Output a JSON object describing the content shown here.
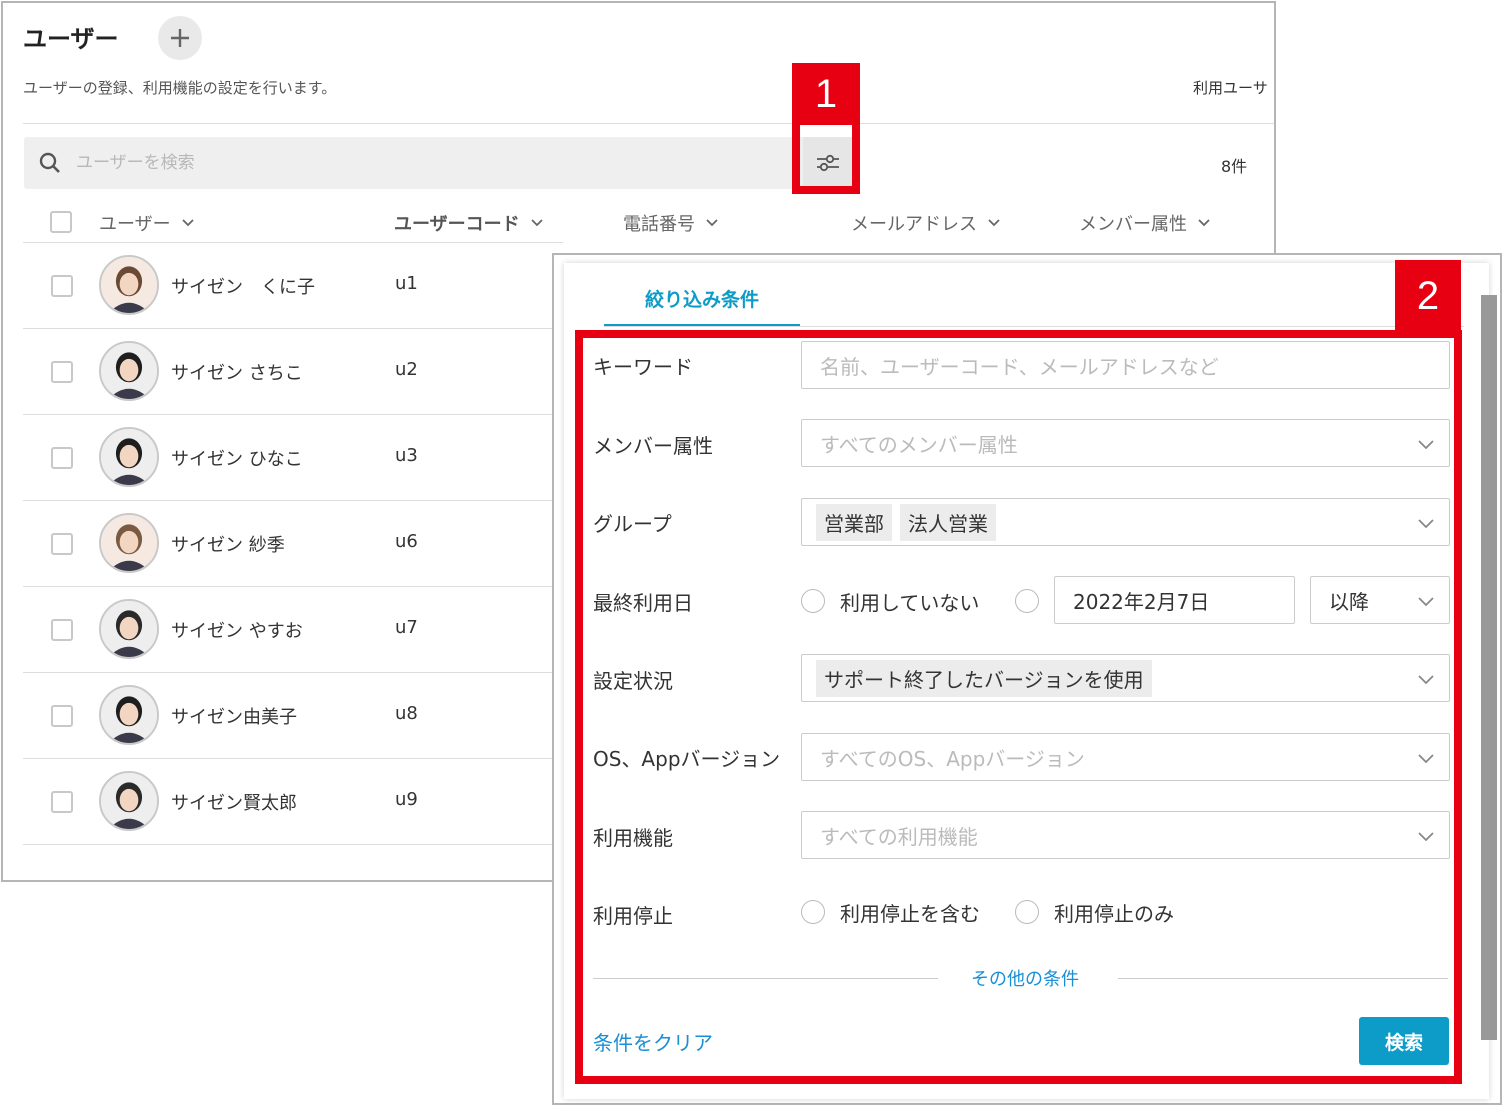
{
  "header": {
    "title": "ユーザー",
    "description": "ユーザーの登録、利用機能の設定を行います。",
    "usage_label": "利用ユーサ"
  },
  "search": {
    "placeholder": "ユーザーを検索",
    "count": "8件"
  },
  "columns": [
    "ユーザー",
    "ユーザーコード",
    "電話番号",
    "メールアドレス",
    "メンバー属性"
  ],
  "rows": [
    {
      "name": "サイゼン　くに子",
      "code": "u1"
    },
    {
      "name": "サイゼン さちこ",
      "code": "u2"
    },
    {
      "name": "サイゼン ひなこ",
      "code": "u3"
    },
    {
      "name": "サイゼン 紗季",
      "code": "u6"
    },
    {
      "name": "サイゼン やすお",
      "code": "u7"
    },
    {
      "name": "サイゼン由美子",
      "code": "u8"
    },
    {
      "name": "サイゼン賢太郎",
      "code": "u9"
    }
  ],
  "callouts": [
    "1",
    "2"
  ],
  "filter": {
    "tab": "絞り込み条件",
    "keyword": {
      "label": "キーワード",
      "placeholder": "名前、ユーザーコード、メールアドレスなど"
    },
    "member": {
      "label": "メンバー属性",
      "placeholder": "すべてのメンバー属性"
    },
    "group": {
      "label": "グループ",
      "tags": [
        "営業部",
        "法人営業"
      ]
    },
    "last_used": {
      "label": "最終利用日",
      "option_none": "利用していない",
      "date": "2022年2月7日",
      "direction": "以降"
    },
    "status": {
      "label": "設定状況",
      "tag": "サポート終了したバージョンを使用"
    },
    "os": {
      "label": "OS、Appバージョン",
      "placeholder": "すべてのOS、Appバージョン"
    },
    "features": {
      "label": "利用機能",
      "placeholder": "すべての利用機能"
    },
    "suspended": {
      "label": "利用停止",
      "include": "利用停止を含む",
      "only": "利用停止のみ"
    },
    "other": "その他の条件",
    "clear": "条件をクリア",
    "submit": "検索"
  },
  "colors": {
    "accent": "#0d9cc8",
    "link": "#1a8fd6",
    "callout": "#e60012"
  }
}
